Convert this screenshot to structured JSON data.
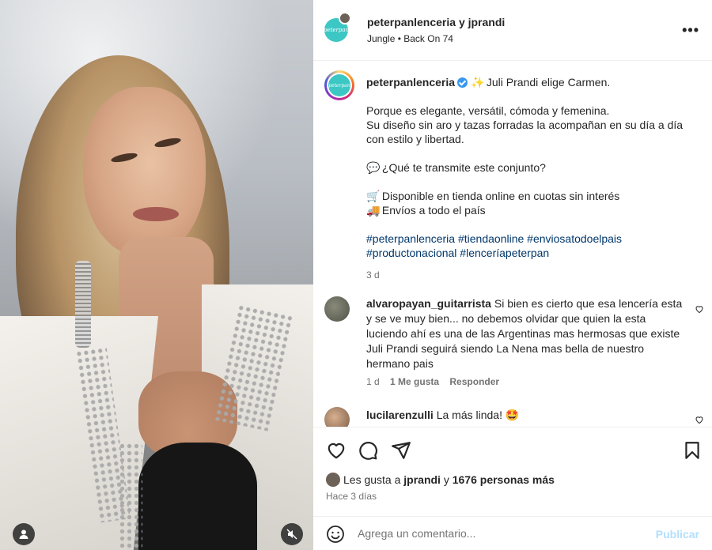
{
  "header": {
    "title": "peterpanlenceria y jprandi",
    "audio": "Jungle • Back On 74",
    "avatar_text": "peterpan",
    "more_label": "•••"
  },
  "caption": {
    "username": "peterpanlenceria",
    "first_line_emoji": "✨",
    "first_line": "Juli Prandi elige Carmen.",
    "line_1": "Porque es elegante, versátil, cómoda y femenina.",
    "line_2": "Su diseño sin aro y tazas forradas la acompañan en su día a día con estilo y libertad.",
    "question_emoji": "💬",
    "question": "¿Qué te transmite este conjunto?",
    "cart_emoji": "🛒",
    "cart_line": "Disponible en tienda online en cuotas sin interés",
    "truck_emoji": "🚚",
    "truck_line": "Envíos a todo el país",
    "tags_line_1": "#peterpanlenceria #tiendaonline #enviosatodoelpais",
    "tags_line_2": "#productonacional #lenceríapeterpan",
    "time": "3 d"
  },
  "comments": [
    {
      "username": "alvaropayan_guitarrista",
      "text": "Si bien es cierto que esa lencería esta y se ve muy bien... no debemos olvidar que quien la esta luciendo ahí es una de las Argentinas mas hermosas que existe Juli Prandi seguirá siendo La Nena mas bella de nuestro hermano pais",
      "time": "1 d",
      "likes": "1 Me gusta",
      "reply": "Responder"
    },
    {
      "username": "lucilarenzulli",
      "text": "La más linda! 🤩"
    }
  ],
  "likes": {
    "prefix": "Les gusta a",
    "user": "jprandi",
    "middle": "y",
    "count": "1676 personas más"
  },
  "date": "Hace 3 días",
  "add_comment": {
    "placeholder": "Agrega un comentario...",
    "post_label": "Publicar"
  },
  "colors": {
    "brand_teal": "#3cc7c4",
    "link_blue": "#00376b",
    "post_disabled": "#b2dffc",
    "muted": "#737373"
  }
}
